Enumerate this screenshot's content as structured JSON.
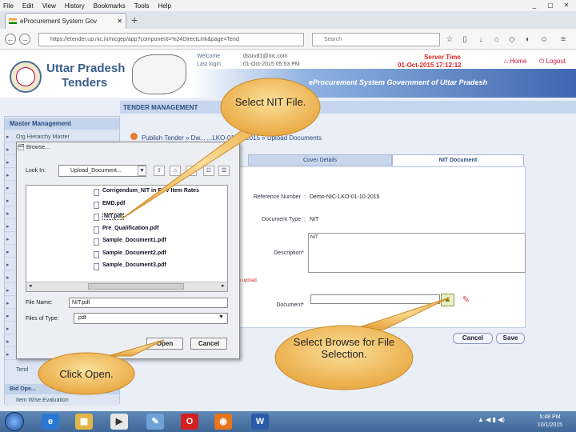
{
  "browser": {
    "menu": [
      "File",
      "Edit",
      "View",
      "History",
      "Bookmarks",
      "Tools",
      "Help"
    ],
    "window_controls": [
      "_",
      "▢",
      "✕"
    ],
    "tab_title": "eProcurement System Gov",
    "url": "https://etender.up.nic.in/nicgep/app?component=%24DirectLink&page=Tend",
    "search_placeholder": "Search"
  },
  "header": {
    "title_line1": "Uttar Pradesh",
    "title_line2": "Tenders",
    "welcome_label": "Welcome",
    "welcome_value": ": dssrvd1@nic.com",
    "lastlogin_label": "Last login",
    "lastlogin_value": ": 01-Oct-2015 05:53 PM",
    "server_time_label": "Server Time",
    "server_time_value": "01-Oct-2015 17:12:12",
    "home": "Home",
    "logout": "Logout",
    "system_title": "eProcurement System Government of Uttar Pradesh"
  },
  "page": {
    "section_title": "TENDER MANAGEMENT",
    "breadcrumb": "Publish Tender  »  Dw...  ...LKO-01-10-2015  »  Upload Documents",
    "sidebar_heading": "Master Management",
    "sidebar_items": [
      "Org Hierarchy Master",
      "Tender",
      "",
      "",
      "",
      "",
      "",
      "",
      "",
      "",
      "",
      "",
      "",
      "",
      "",
      "",
      "",
      ""
    ],
    "sidebar_bottom": [
      "Tend",
      "Bid Ope...",
      "Item Wise Evaluation"
    ],
    "tabs": [
      "Cover Details",
      "NIT Document"
    ],
    "form": {
      "ref_label": "Reference Number",
      "ref_value": "Demo-NIC-LKO-01-10-2015",
      "doctype_label": "Document Type",
      "doctype_value": "NIT",
      "desc_label": "Description*",
      "desc_value": "NIT",
      "upload_hint": "to upload.",
      "doc_label": "Document*",
      "cancel": "Cancel",
      "save": "Save"
    }
  },
  "dialog": {
    "title": "Browse...",
    "lookin_label": "Look In:",
    "lookin_value": "Upload_Document...",
    "files": [
      "Corrigendum_NIT in ECV Item Rates",
      "EMD.pdf",
      "NIT.pdf",
      "Pre_Qualification.pdf",
      "Sample_Document1.pdf",
      "Sample_Document2.pdf",
      "Sample_Document3.pdf"
    ],
    "filename_label": "File Name:",
    "filename_value": "NIT.pdf",
    "filetype_label": "Files of Type:",
    "filetype_value": ".pdf",
    "open": "Open",
    "cancel": "Cancel"
  },
  "callouts": {
    "nit": "Select NIT File.",
    "browse": "Select Browse for File Selection.",
    "open": "Click Open."
  },
  "taskbar": {
    "time": "5:48 PM",
    "date": "10/1/2015"
  },
  "colors": {
    "brand_blue": "#3a5e8a",
    "server_time": "#dd2222",
    "callout_fill": "#f3c46a"
  }
}
